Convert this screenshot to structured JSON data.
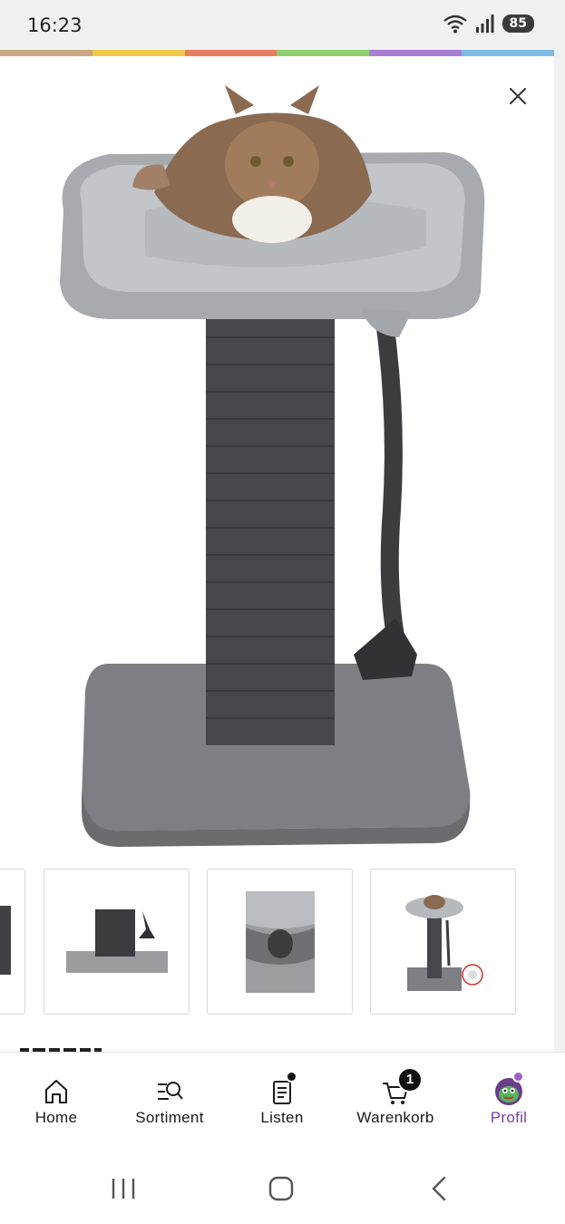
{
  "status_bar": {
    "time": "16:23",
    "battery": "85"
  },
  "brand_colors": [
    "#c9a882",
    "#efc94c",
    "#e97d5f",
    "#8fcf6e",
    "#a97fd4",
    "#7ebbe6"
  ],
  "product": {
    "image_icon": "cat-tree-with-cat-image",
    "thumbnails": [
      {
        "icon": "scratching-post-detail-image"
      },
      {
        "icon": "scratching-post-base-image"
      },
      {
        "icon": "bed-closeup-image"
      },
      {
        "icon": "cat-tree-full-image"
      }
    ]
  },
  "bottom_nav": [
    {
      "label": "Home",
      "icon": "home-icon"
    },
    {
      "label": "Sortiment",
      "icon": "sortiment-search-icon"
    },
    {
      "label": "Listen",
      "icon": "list-icon"
    },
    {
      "label": "Warenkorb",
      "icon": "cart-icon",
      "badge": "1"
    },
    {
      "label": "Profil",
      "icon": "profile-avatar-icon",
      "active": true
    }
  ],
  "colors": {
    "accent": "#7a3fa8",
    "text": "#1a1a1a"
  }
}
